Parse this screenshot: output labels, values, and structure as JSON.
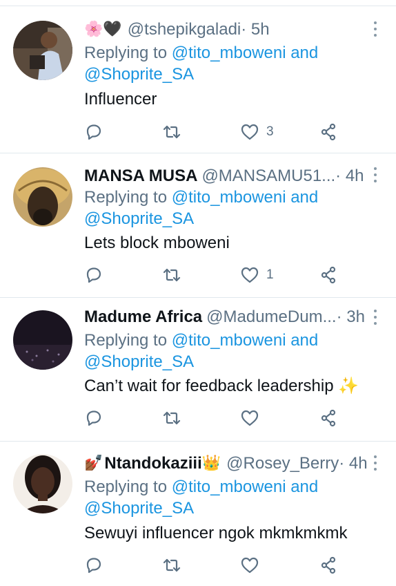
{
  "tweets": [
    {
      "name_emoji": "🌸🖤",
      "display_name": "",
      "handle": "@tshepikgaladi",
      "time": " · 5h",
      "replying_prefix": "Replying to ",
      "mention1": "@tito_mboweni",
      "and_text": " and",
      "mention2": "@Shoprite_SA",
      "text": "Influencer",
      "likes": "3"
    },
    {
      "name_emoji": "",
      "display_name": "MANSA MUSA",
      "handle": "@MANSAMU51...",
      "time": " · 4h",
      "replying_prefix": "Replying to ",
      "mention1": "@tito_mboweni",
      "and_text": " and",
      "mention2": "@Shoprite_SA",
      "text": "Lets block mboweni",
      "likes": "1"
    },
    {
      "name_emoji": "",
      "display_name": "Madume Africa",
      "handle": "@MadumeDum...",
      "time": " · 3h",
      "replying_prefix": "Replying to ",
      "mention1": "@tito_mboweni",
      "and_text": " and",
      "mention2": "@Shoprite_SA",
      "text": "Can’t wait for feedback leadership ✨",
      "likes": ""
    },
    {
      "name_emoji": "💅🏾",
      "display_name": "Ntandokaziii",
      "name_suffix_emoji": "👑",
      "handle": "@Rosey_Berry",
      "time": " · 4h",
      "replying_prefix": "Replying to ",
      "mention1": "@tito_mboweni",
      "and_text": " and",
      "mention2": "@Shoprite_SA",
      "text": "Sewuyi influencer ngok mkmkmkmk",
      "likes": ""
    }
  ],
  "colors": {
    "link": "#1b95e0",
    "secondary_text": "#5b7083",
    "divider": "#e1e8ed"
  },
  "icons": [
    "reply-icon",
    "retweet-icon",
    "like-icon",
    "share-icon",
    "more-options-icon"
  ]
}
